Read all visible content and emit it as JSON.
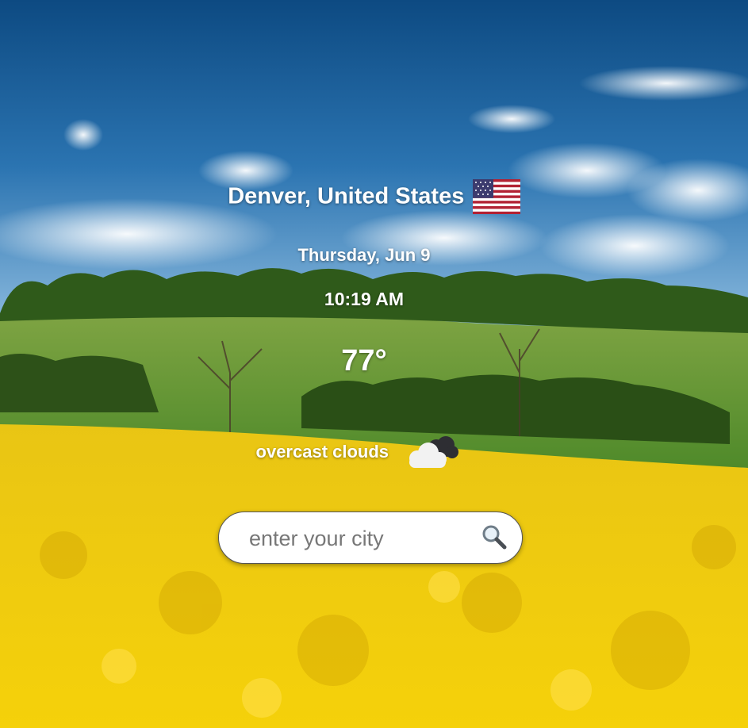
{
  "location": {
    "city_label": "Denver, United States",
    "country_flag_icon": "us-flag-icon"
  },
  "date": "Thursday, Jun 9",
  "time": "10:19 AM",
  "temperature": "77°",
  "condition": {
    "description": "overcast clouds",
    "icon": "overcast-clouds-icon"
  },
  "search": {
    "placeholder": "enter your city",
    "value": "",
    "icon": "search-icon"
  },
  "colors": {
    "sky_top": "#0f4f86",
    "sky_bottom": "#6aa3cf",
    "field_yellow": "#f2c500",
    "grass_green": "#5f8f2a",
    "text": "#ffffff"
  }
}
